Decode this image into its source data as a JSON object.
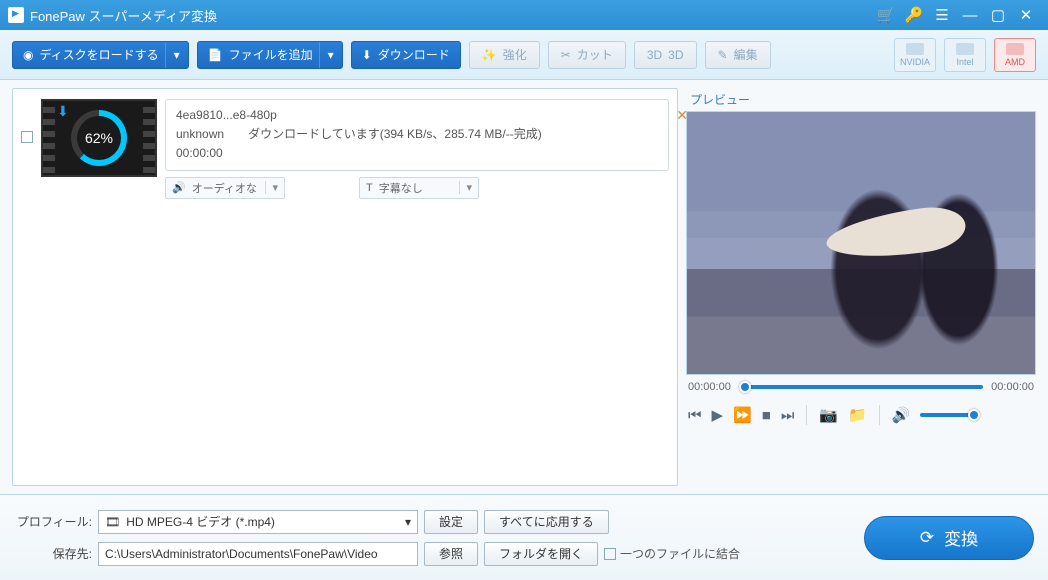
{
  "title": "FonePaw スーパーメディア変換",
  "toolbar": {
    "load_disc_label": "ディスクをロードする",
    "add_file_label": "ファイルを追加",
    "download_label": "ダウンロード",
    "enhance_label": "強化",
    "cut_label": "カット",
    "three_d_label": "3D",
    "edit_label": "編集"
  },
  "gpu": {
    "nvidia": "NVIDIA",
    "intel": "Intel",
    "amd": "AMD"
  },
  "file": {
    "progress_percent": "62%",
    "name": "4ea9810...e8-480p",
    "status_prefix": "unknown",
    "status_text": "ダウンロードしています(394 KB/s、285.74 MB/--完成)",
    "duration": "00:00:00",
    "audio_dd": "オーディオな",
    "subtitle_dd": "字幕なし"
  },
  "preview": {
    "title": "プレビュー",
    "time_left": "00:00:00",
    "time_right": "00:00:00"
  },
  "bottom": {
    "profile_label": "プロフィール:",
    "profile_value": "HD MPEG-4 ビデオ (*.mp4)",
    "settings_label": "設定",
    "apply_all_label": "すべてに応用する",
    "save_to_label": "保存先:",
    "save_to_value": "C:\\Users\\Administrator\\Documents\\FonePaw\\Video",
    "browse_label": "参照",
    "open_folder_label": "フォルダを開く",
    "merge_label": "一つのファイルに結合",
    "convert_label": "変換"
  }
}
